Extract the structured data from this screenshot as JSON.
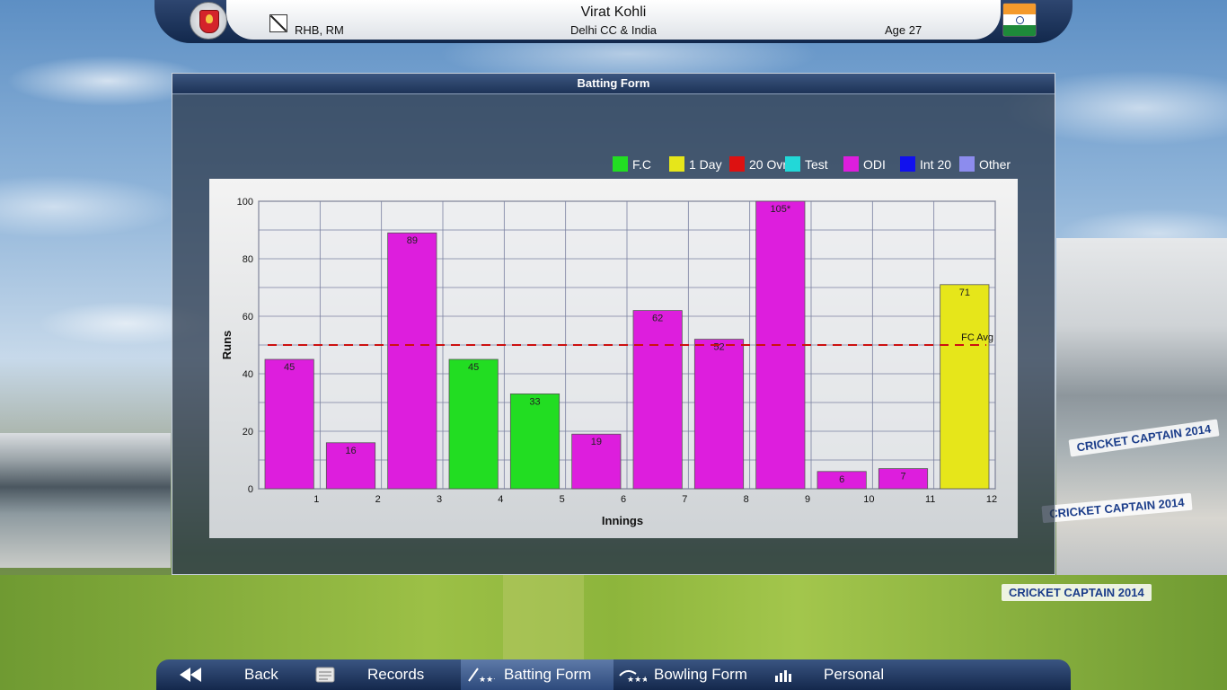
{
  "header": {
    "player_name": "Virat Kohli",
    "batting_style": "RHB, RM",
    "team": "Delhi CC & India",
    "age": "Age 27",
    "crest_icon": "team-crest-icon",
    "flag_icon": "india-flag-icon"
  },
  "panel": {
    "title": "Batting Form"
  },
  "legend": [
    {
      "label": "F.C",
      "color": "#22dd22"
    },
    {
      "label": "1 Day",
      "color": "#e6e61a"
    },
    {
      "label": "20 Ovr",
      "color": "#dd1111"
    },
    {
      "label": "Test",
      "color": "#22d8d8"
    },
    {
      "label": "ODI",
      "color": "#dd1edd"
    },
    {
      "label": "Int 20",
      "color": "#1111ee"
    },
    {
      "label": "Other",
      "color": "#8c8cee"
    }
  ],
  "chart_data": {
    "type": "bar",
    "categories": [
      "1",
      "2",
      "3",
      "4",
      "5",
      "6",
      "7",
      "8",
      "9",
      "10",
      "11",
      "12"
    ],
    "values": [
      45,
      16,
      89,
      45,
      33,
      19,
      62,
      52,
      105,
      6,
      7,
      71
    ],
    "value_labels": [
      "45",
      "16",
      "89",
      "45",
      "33",
      "19",
      "62",
      "52",
      "105*",
      "6",
      "7",
      "71"
    ],
    "bar_types": [
      "ODI",
      "ODI",
      "ODI",
      "F.C",
      "F.C",
      "ODI",
      "ODI",
      "ODI",
      "ODI",
      "ODI",
      "ODI",
      "1 Day"
    ],
    "xlabel": "Innings",
    "ylabel": "Runs",
    "ylim": [
      0,
      100
    ],
    "yticks": [
      "0",
      "20",
      "40",
      "60",
      "80",
      "100"
    ],
    "reference_line": {
      "label": "FC Avg",
      "value": 50,
      "color": "#cc1111"
    },
    "grid": true,
    "legend_position": "top-right"
  },
  "nav": [
    {
      "label": "Back",
      "icon": "back-arrow-icon",
      "active": false
    },
    {
      "label": "Records",
      "icon": "records-icon",
      "active": false
    },
    {
      "label": "Batting Form",
      "icon": "batting-form-icon",
      "active": true
    },
    {
      "label": "Bowling Form",
      "icon": "bowling-form-icon",
      "active": false
    },
    {
      "label": "Personal",
      "icon": "personal-icon",
      "active": false
    }
  ],
  "background_ads": [
    "CRICKET CAPTAIN 2014",
    "CRICKET CAPTAIN 2014",
    "CRICKET CAPTAIN 2014"
  ]
}
